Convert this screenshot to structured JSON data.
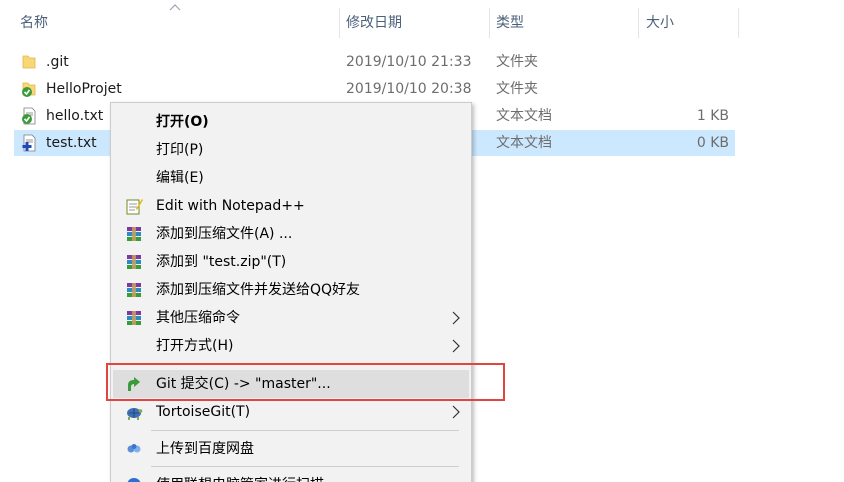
{
  "columns": {
    "name": "名称",
    "date": "修改日期",
    "type": "类型",
    "size": "大小"
  },
  "files": [
    {
      "name": ".git",
      "date": "2019/10/10 21:33",
      "type": "文件夹",
      "size": "",
      "icon": "folder-icon"
    },
    {
      "name": "HelloProjet",
      "date": "2019/10/10 20:38",
      "type": "文件夹",
      "size": "",
      "icon": "git-folder-icon"
    },
    {
      "name": "hello.txt",
      "date": "",
      "type": "文本文档",
      "size": "1 KB",
      "icon": "git-ok-text-icon"
    },
    {
      "name": "test.txt",
      "date": "",
      "type": "文本文档",
      "size": "0 KB",
      "icon": "git-added-text-icon"
    }
  ],
  "menu": {
    "open": "打开(O)",
    "print": "打印(P)",
    "edit": "编辑(E)",
    "notepad": "Edit with Notepad++",
    "add_archive": "添加到压缩文件(A) ...",
    "add_zip": "添加到 \"test.zip\"(T)",
    "add_send_qq": "添加到压缩文件并发送给QQ好友",
    "other_compress": "其他压缩命令",
    "open_with": "打开方式(H)",
    "git_commit": "Git 提交(C) -> \"master\"...",
    "tortoisegit": "TortoiseGit(T)",
    "baidu_upload": "上传到百度网盘",
    "scan": "使用联想电脑管家进行扫描"
  },
  "colors": {
    "selected_row": "#cce8ff",
    "highlight_border": "#e0463f",
    "menu_bg": "#f2f2f2"
  }
}
